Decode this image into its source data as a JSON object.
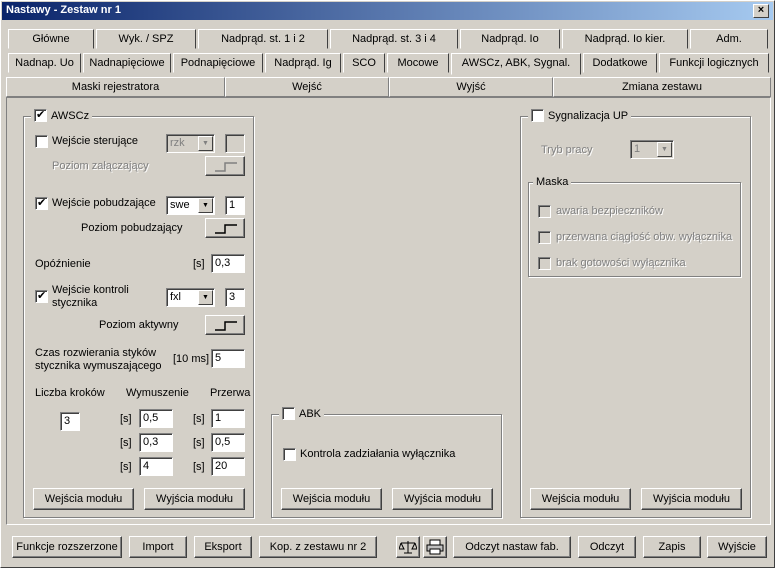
{
  "window": {
    "title": "Nastawy  -  Zestaw nr 1",
    "close_label": "×"
  },
  "tabs_row1": [
    "Główne",
    "Wyk. / SPZ",
    "Nadprąd. st. 1 i 2",
    "Nadprąd. st. 3 i 4",
    "Nadprąd. Io",
    "Nadprąd. Io kier.",
    "Adm."
  ],
  "tabs_row2": [
    "Nadnap. Uo",
    "Nadnapięciowe",
    "Podnapięciowe",
    "Nadprąd. Ig",
    "SCO",
    "Mocowe",
    "AWSCz, ABK, Sygnal.",
    "Dodatkowe",
    "Funkcji logicznych"
  ],
  "subtabs": [
    "Maski rejestratora",
    "Wejść",
    "Wyjść",
    "Zmiana zestawu"
  ],
  "awscz": {
    "title": "AWSCz",
    "checked": true,
    "control_input_label": "Wejście sterujące",
    "control_input_value": "rzk",
    "control_input_num": "",
    "enable_level_label": "Poziom załączający",
    "excite_input_label": "Wejście pobudzające",
    "excite_input_value": "swe",
    "excite_input_num": "1",
    "excite_level_label": "Poziom pobudzający",
    "delay_label": "Opóźnienie",
    "delay_unit": "[s]",
    "delay_value": "0,3",
    "contactor_label": "Wejście kontroli stycznika",
    "contactor_value": "fxl",
    "contactor_num": "3",
    "active_level_label": "Poziom aktywny",
    "open_time_label": "Czas rozwierania styków stycznika wymuszającego",
    "open_time_unit": "[10 ms]",
    "open_time_value": "5",
    "steps_label": "Liczba kroków",
    "steps_value": "3",
    "forcing_label": "Wymuszenie",
    "pause_label": "Przerwa",
    "unit_s": "[s]",
    "steps": [
      {
        "forcing": "0,5",
        "pause": "1"
      },
      {
        "forcing": "0,3",
        "pause": "0,5"
      },
      {
        "forcing": "4",
        "pause": "20"
      }
    ],
    "module_inputs": "Wejścia modułu",
    "module_outputs": "Wyjścia modułu"
  },
  "abk": {
    "title": "ABK",
    "checked": false,
    "breaker_control_label": "Kontrola zadziałania wyłącznika",
    "module_inputs": "Wejścia modułu",
    "module_outputs": "Wyjścia modułu"
  },
  "sygnal": {
    "title": "Sygnalizacja UP",
    "checked": false,
    "mode_label": "Tryb pracy",
    "mode_value": "1",
    "mask_title": "Maska",
    "mask_items": [
      "awaria bezpieczników",
      "przerwana ciągłość obw. wyłącznika",
      "brak gotowości wyłącznika"
    ],
    "module_inputs": "Wejścia modułu",
    "module_outputs": "Wyjścia modułu"
  },
  "bottom": {
    "extended_functions": "Funkcje rozszerzone",
    "import": "Import",
    "export": "Eksport",
    "copy_from_set": "Kop. z zestawu nr 2",
    "compare_icon": "scales-icon",
    "print_icon": "printer-icon",
    "read_factory": "Odczyt nastaw fab.",
    "read": "Odczyt",
    "save": "Zapis",
    "exit": "Wyjście"
  }
}
